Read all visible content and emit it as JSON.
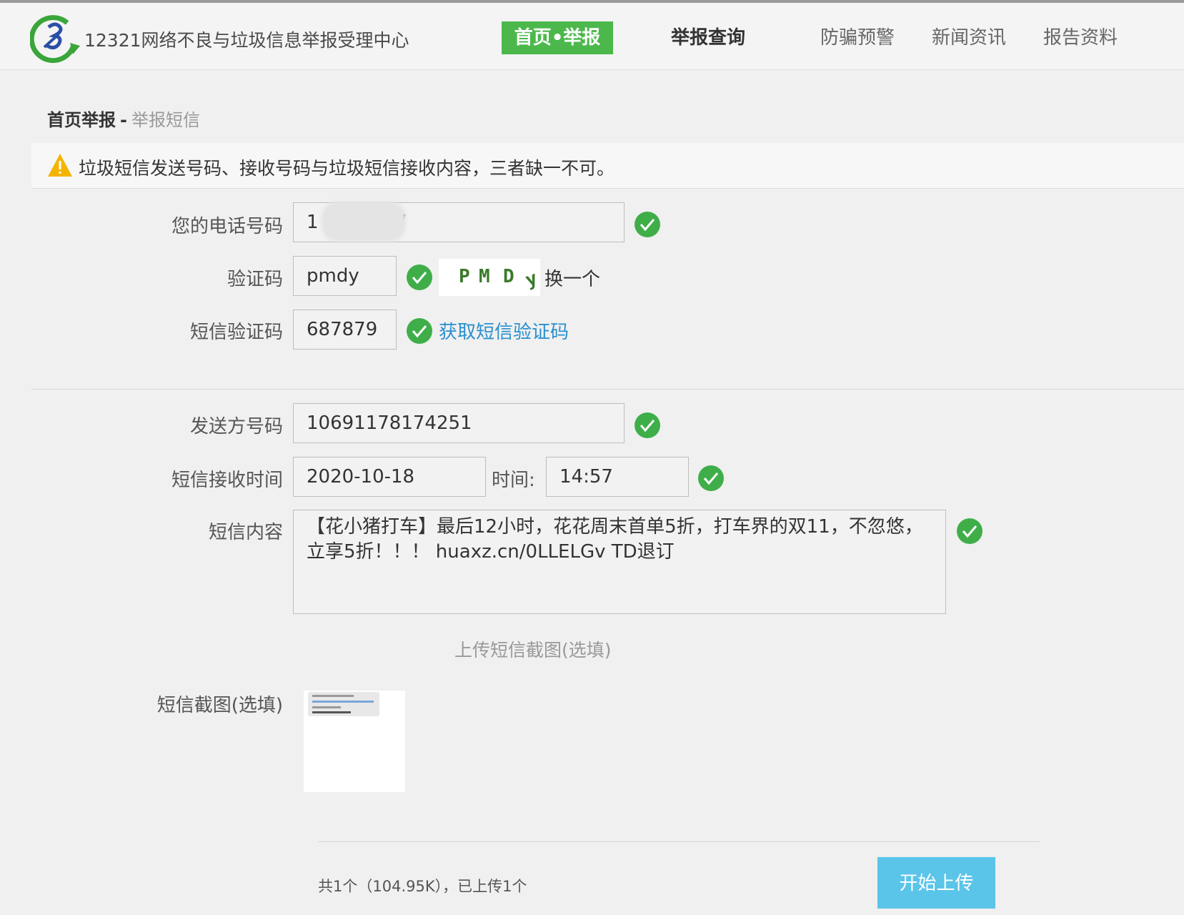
{
  "header": {
    "site_title": "12321网络不良与垃圾信息举报受理中心",
    "nav": [
      {
        "label": "首页•举报"
      },
      {
        "label": "举报查询"
      },
      {
        "label": "防骗预警"
      },
      {
        "label": "新闻资讯"
      },
      {
        "label": "报告资料"
      }
    ]
  },
  "breadcrumb": {
    "main": "首页举报",
    "separator": "-",
    "sub": "举报短信"
  },
  "warning": {
    "text": "垃圾短信发送号码、接收号码与垃圾短信接收内容，三者缺一不可。"
  },
  "form": {
    "phone": {
      "label": "您的电话号码",
      "value": "1           27"
    },
    "captcha": {
      "label": "验证码",
      "value": "pmdy",
      "image_chars": [
        "P",
        "M",
        "D",
        "y"
      ],
      "refresh_label": "换一个"
    },
    "sms_code": {
      "label": "短信验证码",
      "value": "687879",
      "get_code_label": "获取短信验证码"
    },
    "sender": {
      "label": "发送方号码",
      "value": "10691178174251"
    },
    "receive_time": {
      "label": "短信接收时间",
      "date": "2020-10-18",
      "time_label": "时间:",
      "time": "14:57"
    },
    "content": {
      "label": "短信内容",
      "value": "【花小猪打车】最后12小时，花花周末首单5折，打车界的双11，不忽悠，立享5折！！！ huaxz.cn/0LLELGv TD退订"
    },
    "upload_hint": "上传短信截图(选填)",
    "screenshot": {
      "label": "短信截图(选填)"
    }
  },
  "upload": {
    "status": "共1个（104.95K），已上传1个",
    "button_label": "开始上传"
  },
  "colors": {
    "accent_green": "#4cb84c",
    "check_green": "#3fae49",
    "link_blue": "#2a8fcf",
    "upload_button": "#5bc4e9",
    "warning_yellow": "#f5b400"
  }
}
